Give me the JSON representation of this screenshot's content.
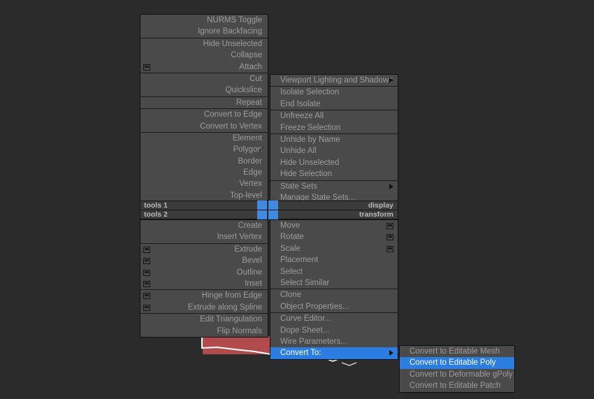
{
  "app": {
    "background_color": "#2b2b2b",
    "menu_bg": "#4a4a4a",
    "highlight_color": "#2b7de0",
    "text_color": "#9d9d9d",
    "accent_blue": "#3f8ae0",
    "accent_red": "#b14a4a"
  },
  "quad_titles": {
    "tools1": "tools 1",
    "tools2": "tools 2",
    "display": "display",
    "transform": "transform"
  },
  "left_menu": {
    "groups": [
      {
        "items": [
          {
            "label": "NURMS Toggle",
            "box": false,
            "check": false,
            "arrow": false,
            "state": "normal"
          },
          {
            "label": "Ignore Backfacing",
            "box": false,
            "check": false,
            "arrow": false,
            "state": "normal"
          }
        ]
      },
      {
        "items": [
          {
            "label": "Hide Unselected",
            "box": false,
            "check": false,
            "arrow": false,
            "state": "normal"
          },
          {
            "label": "Collapse",
            "box": false,
            "check": false,
            "arrow": false,
            "state": "normal"
          },
          {
            "label": "Attach",
            "box": true,
            "check": false,
            "arrow": false,
            "state": "normal"
          }
        ]
      },
      {
        "items": [
          {
            "label": "Cut",
            "box": false,
            "check": false,
            "arrow": false,
            "state": "normal"
          },
          {
            "label": "Quickslice",
            "box": false,
            "check": false,
            "arrow": false,
            "state": "normal"
          }
        ]
      },
      {
        "items": [
          {
            "label": "Repeat",
            "box": false,
            "check": false,
            "arrow": false,
            "state": "normal"
          }
        ]
      },
      {
        "items": [
          {
            "label": "Convert to Edge",
            "box": false,
            "check": false,
            "arrow": false,
            "state": "normal"
          },
          {
            "label": "Convert to Vertex",
            "box": false,
            "check": false,
            "arrow": false,
            "state": "normal"
          }
        ]
      },
      {
        "items": [
          {
            "label": "Element",
            "box": false,
            "check": false,
            "arrow": false,
            "state": "normal"
          },
          {
            "label": "Polygon",
            "box": false,
            "check": true,
            "arrow": false,
            "state": "normal"
          },
          {
            "label": "Border",
            "box": false,
            "check": false,
            "arrow": false,
            "state": "normal"
          },
          {
            "label": "Edge",
            "box": false,
            "check": false,
            "arrow": false,
            "state": "normal"
          },
          {
            "label": "Vertex",
            "box": false,
            "check": false,
            "arrow": false,
            "state": "normal"
          },
          {
            "label": "Top-level",
            "box": false,
            "check": false,
            "arrow": false,
            "state": "normal"
          }
        ]
      }
    ]
  },
  "left_menu_lower": {
    "groups": [
      {
        "items": [
          {
            "label": "Create",
            "box": false,
            "check": false,
            "arrow": false,
            "state": "normal"
          },
          {
            "label": "Insert Vertex",
            "box": false,
            "check": false,
            "arrow": false,
            "state": "normal"
          }
        ]
      },
      {
        "items": [
          {
            "label": "Extrude",
            "box": true,
            "check": false,
            "arrow": false,
            "state": "normal"
          },
          {
            "label": "Bevel",
            "box": true,
            "check": false,
            "arrow": false,
            "state": "normal"
          },
          {
            "label": "Outline",
            "box": true,
            "check": false,
            "arrow": false,
            "state": "normal"
          },
          {
            "label": "Inset",
            "box": true,
            "check": false,
            "arrow": false,
            "state": "normal"
          }
        ]
      },
      {
        "items": [
          {
            "label": "Hinge from Edge",
            "box": true,
            "check": false,
            "arrow": false,
            "state": "normal"
          },
          {
            "label": "Extrude along Spline",
            "box": true,
            "check": false,
            "arrow": false,
            "state": "normal"
          }
        ]
      },
      {
        "items": [
          {
            "label": "Edit Triangulation",
            "box": false,
            "check": false,
            "arrow": false,
            "state": "normal"
          },
          {
            "label": "Flip Normals",
            "box": false,
            "check": false,
            "arrow": false,
            "state": "normal"
          }
        ]
      }
    ]
  },
  "right_menu": {
    "groups": [
      {
        "items": [
          {
            "label": "Viewport Lighting and Shadows",
            "box": false,
            "check": false,
            "arrow": true,
            "state": "normal"
          }
        ]
      },
      {
        "items": [
          {
            "label": "Isolate Selection",
            "box": false,
            "check": false,
            "arrow": false,
            "state": "normal"
          },
          {
            "label": "End Isolate",
            "box": false,
            "check": false,
            "arrow": false,
            "state": "normal"
          }
        ]
      },
      {
        "items": [
          {
            "label": "Unfreeze All",
            "box": false,
            "check": false,
            "arrow": false,
            "state": "normal"
          },
          {
            "label": "Freeze Selection",
            "box": false,
            "check": false,
            "arrow": false,
            "state": "normal"
          }
        ]
      },
      {
        "items": [
          {
            "label": "Unhide by Name",
            "box": false,
            "check": false,
            "arrow": false,
            "state": "normal"
          },
          {
            "label": "Unhide All",
            "box": false,
            "check": false,
            "arrow": false,
            "state": "normal"
          },
          {
            "label": "Hide Unselected",
            "box": false,
            "check": false,
            "arrow": false,
            "state": "normal"
          },
          {
            "label": "Hide Selection",
            "box": false,
            "check": false,
            "arrow": false,
            "state": "normal"
          }
        ]
      },
      {
        "items": [
          {
            "label": "State Sets",
            "box": false,
            "check": false,
            "arrow": true,
            "state": "normal"
          },
          {
            "label": "Manage State Sets...",
            "box": false,
            "check": false,
            "arrow": false,
            "state": "normal"
          }
        ]
      }
    ]
  },
  "right_menu_lower": {
    "groups": [
      {
        "items": [
          {
            "label": "Move",
            "box": true,
            "check": false,
            "arrow": false,
            "state": "normal"
          },
          {
            "label": "Rotate",
            "box": true,
            "check": false,
            "arrow": false,
            "state": "normal"
          },
          {
            "label": "Scale",
            "box": true,
            "check": false,
            "arrow": false,
            "state": "normal"
          },
          {
            "label": "Placement",
            "box": false,
            "check": false,
            "arrow": false,
            "state": "normal"
          },
          {
            "label": "Select",
            "box": false,
            "check": false,
            "arrow": false,
            "state": "normal"
          },
          {
            "label": "Select Similar",
            "box": false,
            "check": false,
            "arrow": false,
            "state": "normal"
          }
        ]
      },
      {
        "items": [
          {
            "label": "Clone",
            "box": false,
            "check": false,
            "arrow": false,
            "state": "normal"
          },
          {
            "label": "Object Properties...",
            "box": false,
            "check": false,
            "arrow": false,
            "state": "normal"
          }
        ]
      },
      {
        "items": [
          {
            "label": "Curve Editor...",
            "box": false,
            "check": false,
            "arrow": false,
            "state": "normal"
          },
          {
            "label": "Dope Sheet...",
            "box": false,
            "check": false,
            "arrow": false,
            "state": "normal"
          },
          {
            "label": "Wire Parameters...",
            "box": false,
            "check": false,
            "arrow": false,
            "state": "normal"
          },
          {
            "label": "Convert To:",
            "box": false,
            "check": false,
            "arrow": true,
            "state": "highlight"
          }
        ]
      }
    ]
  },
  "submenu": {
    "items": [
      {
        "label": "Convert to Editable Mesh",
        "state": "normal"
      },
      {
        "label": "Convert to Editable Poly",
        "state": "highlight"
      },
      {
        "label": "Convert to Deformable gPoly",
        "state": "normal"
      },
      {
        "label": "Convert to Editable Patch",
        "state": "normal"
      }
    ]
  }
}
